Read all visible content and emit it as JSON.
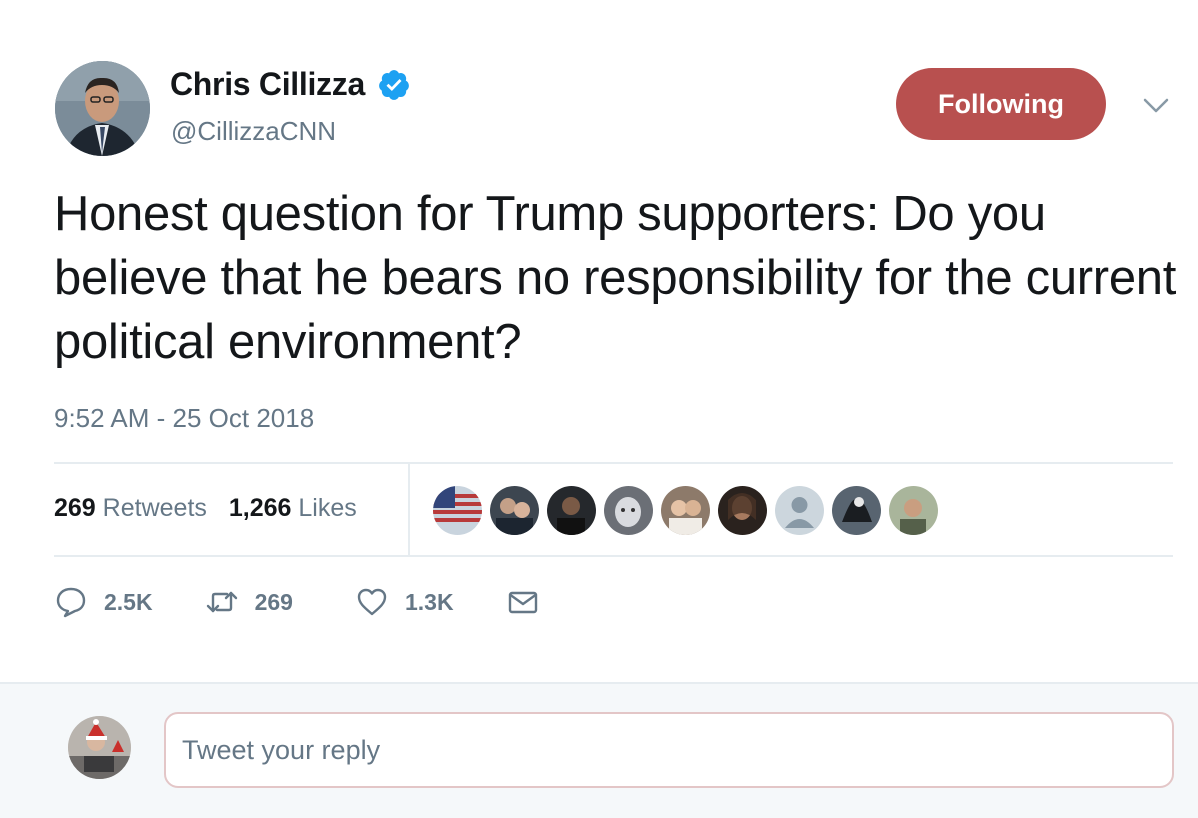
{
  "author": {
    "name": "Chris Cillizza",
    "handle": "@CillizzaCNN",
    "verified": true
  },
  "follow_button": {
    "label": "Following",
    "color": "#b8504f"
  },
  "tweet": {
    "text": "Honest question for Trump supporters: Do you believe that he bears no responsibility for the current political environment?",
    "timestamp": "9:52 AM - 25 Oct 2018"
  },
  "stats": {
    "retweets_count": "269",
    "retweets_label": "Retweets",
    "likes_count": "1,266",
    "likes_label": "Likes"
  },
  "actions": {
    "replies": "2.5K",
    "retweets": "269",
    "likes": "1.3K"
  },
  "reply_box": {
    "placeholder": "Tweet your reply"
  },
  "icons": {
    "verified": "verified-badge-icon",
    "caret": "chevron-down-icon",
    "reply": "reply-icon",
    "retweet": "retweet-icon",
    "like": "heart-icon",
    "message": "envelope-icon"
  },
  "colors": {
    "text": "#14171a",
    "secondary": "#657786",
    "verified_blue": "#1da1f2",
    "divider": "#e6ecf0"
  }
}
